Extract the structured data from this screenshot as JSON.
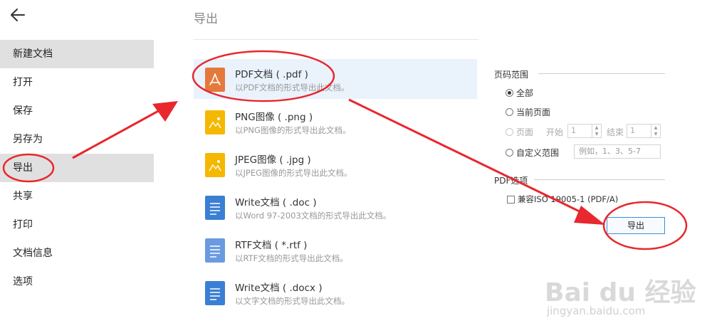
{
  "sidebar": {
    "items": [
      {
        "label": "新建文档",
        "active": true
      },
      {
        "label": "打开",
        "active": false
      },
      {
        "label": "保存",
        "active": false
      },
      {
        "label": "另存为",
        "active": false
      },
      {
        "label": "导出",
        "active": true
      },
      {
        "label": "共享",
        "active": false
      },
      {
        "label": "打印",
        "active": false
      },
      {
        "label": "文档信息",
        "active": false
      },
      {
        "label": "选项",
        "active": false
      }
    ]
  },
  "main": {
    "title": "导出",
    "formats": [
      {
        "name": "PDF文档 ( .pdf )",
        "desc": "以PDF文档的形式导出此文档。",
        "icon": "pdf-icon",
        "color": "#e5793b"
      },
      {
        "name": "PNG图像 ( .png )",
        "desc": "以PNG图像的形式导出此文档。",
        "icon": "image-icon",
        "color": "#f5b800"
      },
      {
        "name": "JPEG图像 ( .jpg )",
        "desc": "以JPEG图像的形式导出此文档。",
        "icon": "image-icon",
        "color": "#f5b800"
      },
      {
        "name": "Write文档 ( .doc )",
        "desc": "以Word 97-2003文档的形式导出此文档。",
        "icon": "document-icon",
        "color": "#3b7fd4"
      },
      {
        "name": "RTF文档 ( *.rtf )",
        "desc": "以RTF文档的形式导出此文档。",
        "icon": "document-icon",
        "color": "#6a9be0"
      },
      {
        "name": "Write文档 ( .docx )",
        "desc": "以文字文档的形式导出此文档。",
        "icon": "document-icon",
        "color": "#3b7fd4"
      }
    ]
  },
  "panel": {
    "range_title": "页码范围",
    "all": "全部",
    "current": "当前页面",
    "pages": "页面",
    "start": "开始",
    "end": "结束",
    "start_value": "1",
    "end_value": "1",
    "custom": "自定义范围",
    "custom_placeholder": "例如，1、3、5-7",
    "pdf_title": "PDF选项",
    "compat": "兼容ISO 19005-1 (PDF/A)",
    "export_button": "导出"
  },
  "watermark": {
    "brand": "Bai du 经验",
    "url": "jingyan.baidu.com"
  },
  "colors": {
    "annotation": "#e8272e",
    "accent": "#3a8fd9"
  }
}
